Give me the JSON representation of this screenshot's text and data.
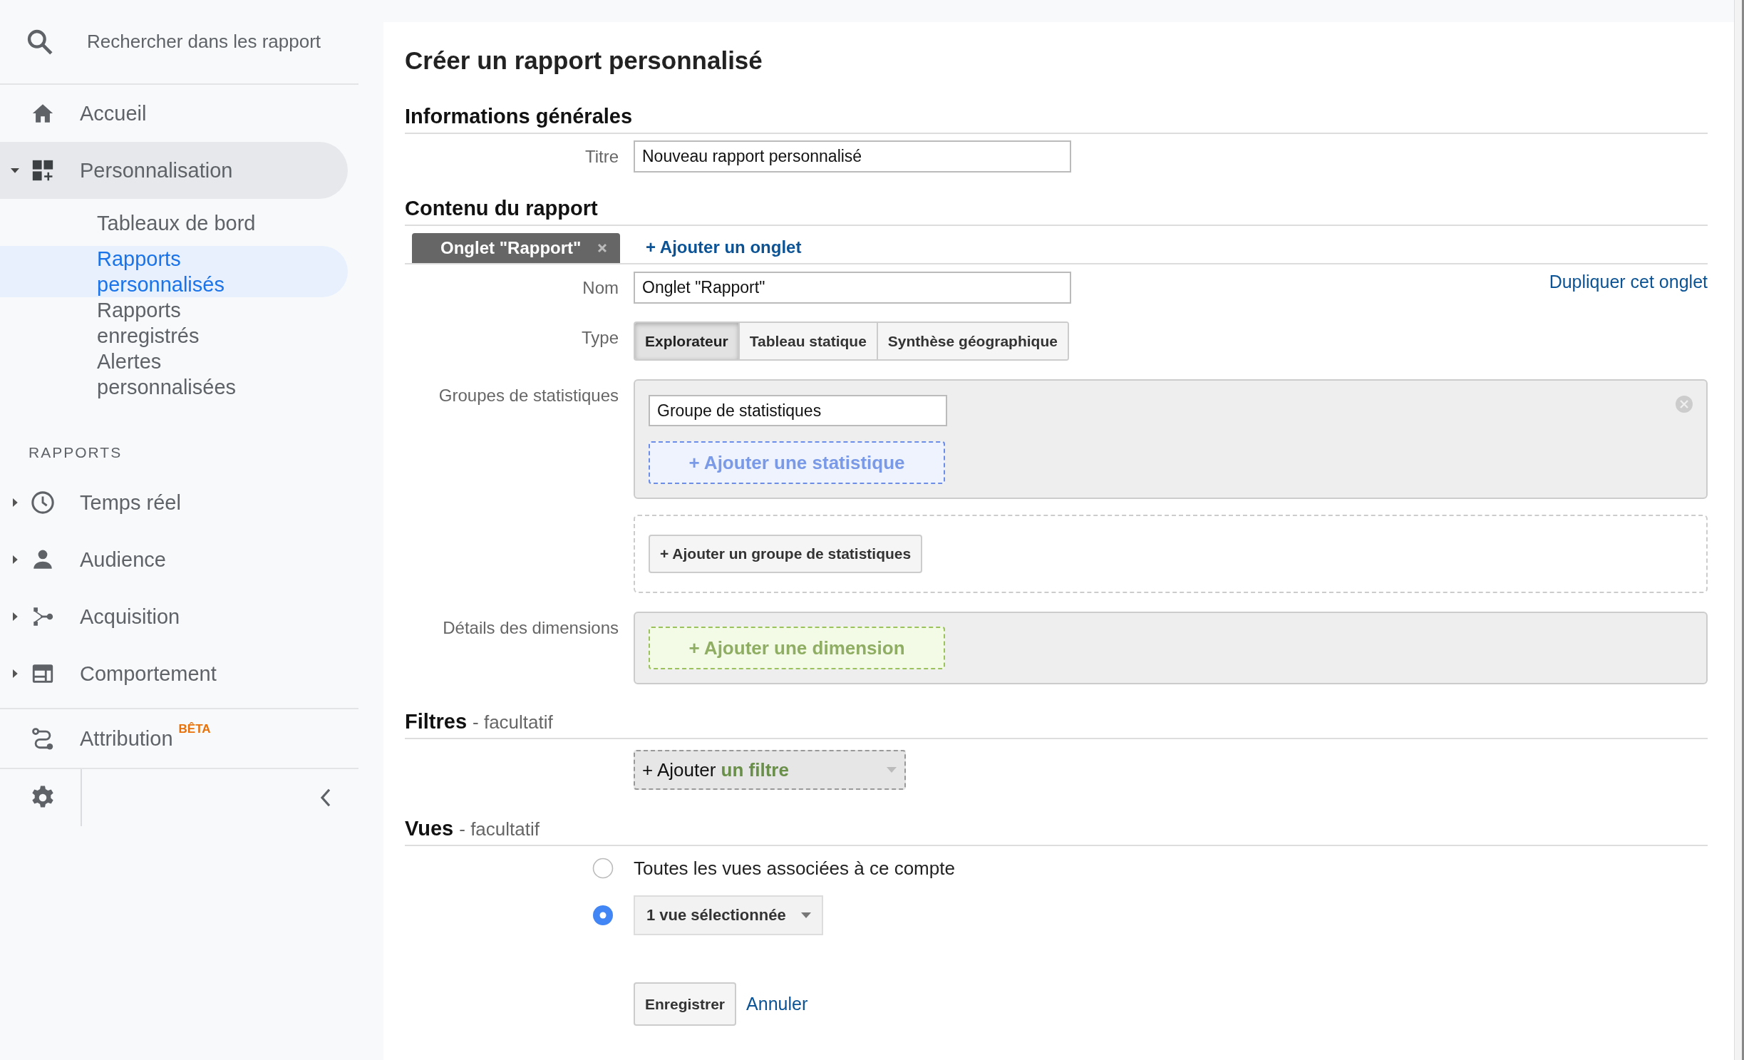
{
  "sidebar": {
    "search": {
      "placeholder": "Rechercher dans les rapport"
    },
    "home": {
      "label": "Accueil",
      "selected": false
    },
    "customization": {
      "label": "Personnalisation",
      "expanded": true,
      "selected": true,
      "children": [
        {
          "label": "Tableaux de bord",
          "selected": false
        },
        {
          "label": "Rapports personnalisés",
          "selected": true
        },
        {
          "label": "Rapports enregistrés",
          "selected": false
        },
        {
          "label": "Alertes personnalisées",
          "selected": false
        }
      ]
    },
    "reports_heading": "RAPPORTS",
    "reports": [
      {
        "label": "Temps réel",
        "expanded": false
      },
      {
        "label": "Audience",
        "expanded": false
      },
      {
        "label": "Acquisition",
        "expanded": false
      },
      {
        "label": "Comportement",
        "expanded": false
      }
    ],
    "attribution": {
      "label": "Attribution",
      "badge": "BÊTA"
    }
  },
  "page": {
    "title": "Créer un rapport personnalisé"
  },
  "general": {
    "heading": "Informations générales",
    "title_label": "Titre",
    "title_value": "Nouveau rapport personnalisé"
  },
  "content": {
    "heading": "Contenu du rapport",
    "tabs": [
      {
        "label": "Onglet \"Rapport\"",
        "selected": true
      }
    ],
    "add_tab": "+ Ajouter un onglet",
    "name_label": "Nom",
    "name_value": "Onglet \"Rapport\"",
    "duplicate": "Dupliquer cet onglet",
    "type_label": "Type",
    "types": [
      {
        "label": "Explorateur",
        "selected": true
      },
      {
        "label": "Tableau statique",
        "selected": false
      },
      {
        "label": "Synthèse géographique",
        "selected": false
      }
    ],
    "metric_groups_label": "Groupes de statistiques",
    "metric_groups": [
      {
        "name": "Groupe de statistiques",
        "add_metric": "+ Ajouter une statistique"
      }
    ],
    "add_group": "+ Ajouter un groupe de statistiques",
    "dimensions_label": "Détails des dimensions",
    "add_dimension": "+ Ajouter une dimension"
  },
  "filters": {
    "heading": "Filtres",
    "note": "- facultatif",
    "add_filter": "+ Ajouter **un filtre**"
  },
  "views": {
    "heading": "Vues",
    "note": "- facultatif",
    "options": [
      {
        "kind": "text",
        "label": "Toutes les vues associées à ce compte",
        "selected": false
      },
      {
        "kind": "dropdown",
        "label": "1 vue sélectionnée",
        "selected": true
      }
    ]
  },
  "actions": {
    "save": "Enregistrer",
    "cancel": "Annuler"
  }
}
